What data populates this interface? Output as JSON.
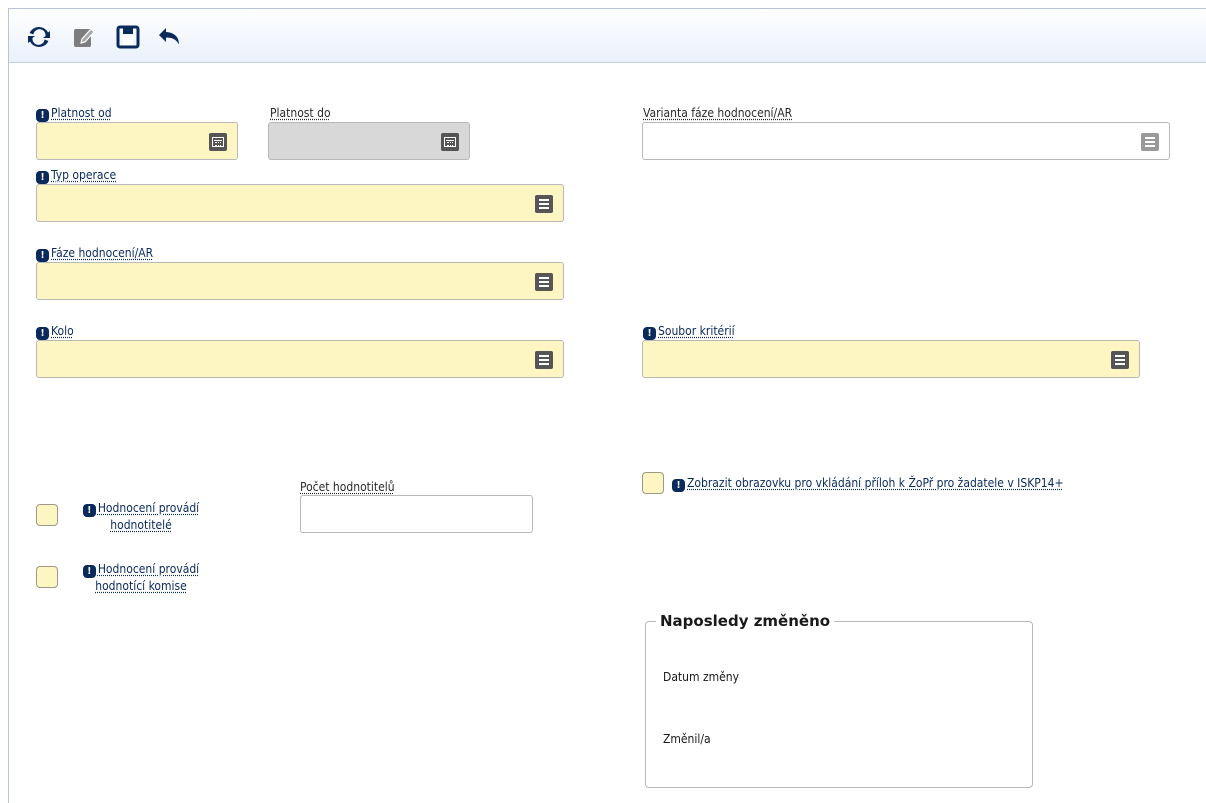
{
  "toolbar": {
    "buttons": [
      {
        "name": "refresh",
        "icon": "refresh-icon"
      },
      {
        "name": "edit",
        "icon": "edit-icon"
      },
      {
        "name": "save",
        "icon": "save-icon"
      },
      {
        "name": "undo",
        "icon": "undo-icon"
      }
    ]
  },
  "required_marker": "!",
  "fields": {
    "platnost_od": {
      "label": "Platnost od",
      "value": ""
    },
    "platnost_do": {
      "label": "Platnost do",
      "value": ""
    },
    "varianta": {
      "label": "Varianta fáze hodnocení/AR",
      "value": ""
    },
    "typ_operace": {
      "label": "Typ operace",
      "value": ""
    },
    "faze": {
      "label": "Fáze hodnocení/AR",
      "value": ""
    },
    "kolo": {
      "label": "Kolo",
      "value": ""
    },
    "soubor": {
      "label": "Soubor kritérií",
      "value": ""
    },
    "pocet": {
      "label": "Počet hodnotitelů",
      "value": ""
    }
  },
  "checkboxes": {
    "hodnotitele": {
      "label_line1": "Hodnocení provádí",
      "label_line2": "hodnotitelé",
      "checked": false
    },
    "komise": {
      "label_line1": "Hodnocení provádí",
      "label_line2": "hodnotící komise",
      "checked": false
    },
    "zobrazit": {
      "label": "Zobrazit obrazovku pro vkládání příloh k ŽoPř pro žadatele v ISKP14+",
      "checked": false
    }
  },
  "last_changed": {
    "title": "Naposledy změněno",
    "date_label": "Datum změny",
    "date_value": "",
    "by_label": "Změnil/a",
    "by_value": ""
  },
  "colors": {
    "required_field": "#fdf6c3",
    "disabled_field": "#d8d8d8",
    "label": "#0b2a5c",
    "toolbar_icon": "#0b2a5c"
  }
}
